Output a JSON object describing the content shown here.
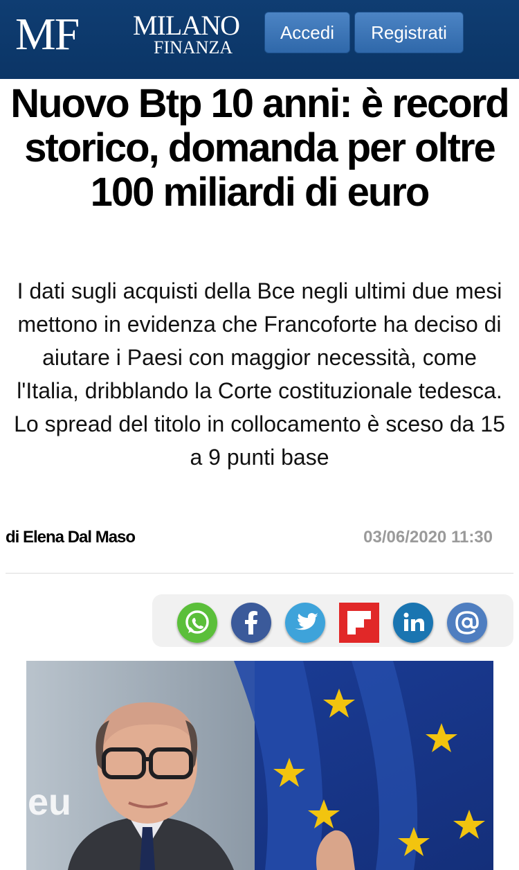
{
  "header": {
    "logo": {
      "mf": "MF",
      "milano": "MILANO",
      "finanza": "FINANZA"
    },
    "login_label": "Accedi",
    "register_label": "Registrati"
  },
  "article": {
    "title": "Nuovo Btp 10 anni: è record storico, domanda per oltre 100 miliardi di euro",
    "summary": "I dati sugli acquisti della Bce negli ultimi due mesi mettono in evidenza che Francoforte ha deciso di aiutare i Paesi con maggior necessità, come l'Italia, dribblando la Corte costituzionale tedesca. Lo spread del titolo in collocamento è sceso da 15 a 9 punti base",
    "author": "di Elena Dal Maso",
    "date": "03/06/2020 11:30"
  },
  "share": {
    "icons": [
      "whatsapp-icon",
      "facebook-icon",
      "twitter-icon",
      "flipboard-icon",
      "linkedin-icon",
      "email-icon"
    ],
    "colors": {
      "whatsapp": "#5bbf3a",
      "facebook": "#3b5a9a",
      "twitter": "#3ea3da",
      "flipboard": "#e12828",
      "linkedin": "#1a75b1",
      "email": "#4f7ec0"
    }
  },
  "photo": {
    "background_text": "eu"
  },
  "colors": {
    "header_bg": "#0f3d72",
    "button_bg": "#3a74b6",
    "date_text": "#9a9a9a"
  }
}
